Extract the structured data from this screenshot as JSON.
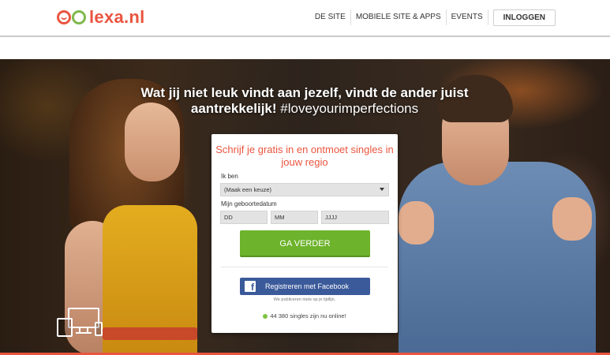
{
  "brand": {
    "logo_text": "lexa.nl"
  },
  "nav": {
    "items": [
      "DE SITE",
      "MOBIELE SITE & APPS",
      "EVENTS"
    ],
    "login_label": "INLOGGEN"
  },
  "hero": {
    "headline": "Wat jij niet leuk vindt aan jezelf, vindt de ander juist aantrekkelijk!",
    "hashtag": "#loveyourimperfections"
  },
  "signup": {
    "title": "Schrijf je gratis in en ontmoet singles in jouw regio",
    "gender_label": "Ik ben",
    "gender_value": "(Maak een keuze)",
    "birthdate_label": "Mijn geboortedatum",
    "day_placeholder": "DD",
    "month_placeholder": "MM",
    "year_placeholder": "JJJJ",
    "submit_label": "GA VERDER",
    "facebook_label": "Registreren met Facebook",
    "facebook_note": "We publiceren niets op je tijdlijn.",
    "online_text": "44 380 singles zijn nu online!"
  },
  "colors": {
    "brand_orange": "#e9553f",
    "brand_green": "#7fb84c",
    "cta_green": "#6db32b",
    "facebook_blue": "#3b5a9a"
  }
}
